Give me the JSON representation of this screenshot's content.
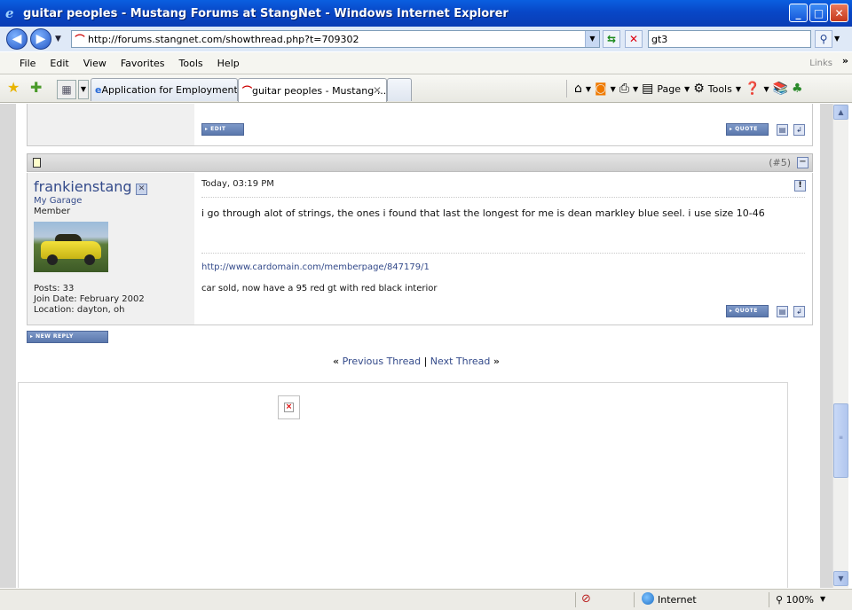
{
  "window": {
    "title": "guitar peoples - Mustang Forums at StangNet - Windows Internet Explorer"
  },
  "address": {
    "url": "http://forums.stangnet.com/showthread.php?t=709302"
  },
  "search": {
    "query": "gt3"
  },
  "menu": {
    "items": [
      "File",
      "Edit",
      "View",
      "Favorites",
      "Tools",
      "Help"
    ],
    "links": "Links"
  },
  "tabs": [
    {
      "label": "Application for Employment"
    },
    {
      "label": "guitar peoples - Mustang ..."
    }
  ],
  "commands": {
    "page": "Page",
    "tools": "Tools"
  },
  "post4": {
    "edit_btn": "EDIT",
    "quote_btn": "QUOTE"
  },
  "post5": {
    "number": "(#5)",
    "username": "frankienstang",
    "garage": "My Garage",
    "rank": "Member",
    "posts": "Posts: 33",
    "join_date": "Join Date: February 2002",
    "location": "Location: dayton, oh",
    "date": "Today, 03:19 PM",
    "message": "i go through alot of strings, the ones i found that last the longest for me is dean markley blue seel. i use size 10-46",
    "sig_link": "http://www.cardomain.com/memberpage/847179/1",
    "sig_text": "car sold, now have a 95 red gt with red black interior",
    "quote_btn": "QUOTE"
  },
  "new_reply_btn": "NEW REPLY",
  "thread_nav": {
    "prev": "Previous Thread",
    "next": "Next Thread",
    "sep": "|",
    "left_quote": "«",
    "right_quote": "»"
  },
  "status": {
    "zone": "Internet",
    "zoom": "100%"
  }
}
